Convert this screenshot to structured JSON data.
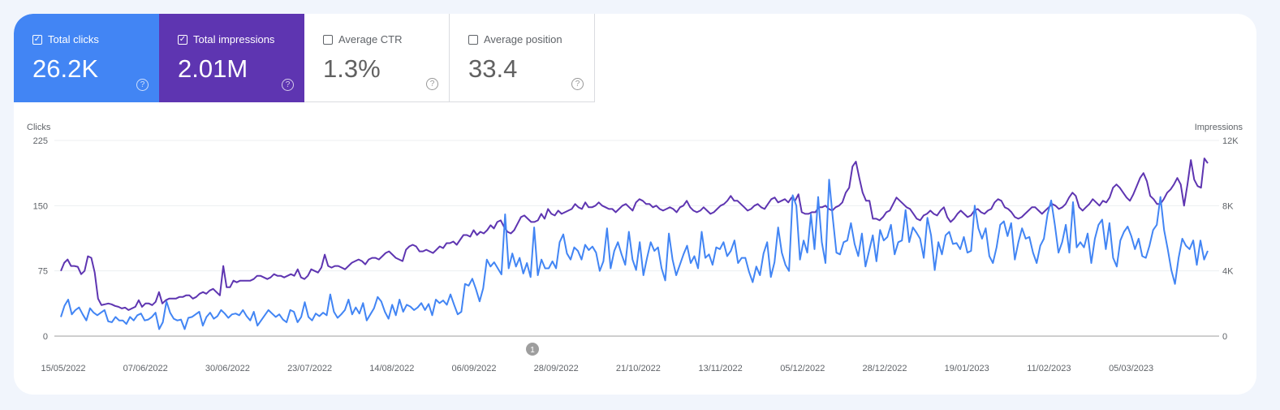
{
  "cards": [
    {
      "label": "Total clicks",
      "value": "26.2K",
      "checked": true,
      "color": "#4285f4",
      "help_icon": "help-circle-icon"
    },
    {
      "label": "Total impressions",
      "value": "2.01M",
      "checked": true,
      "color": "#5e35b1",
      "help_icon": "help-circle-icon"
    },
    {
      "label": "Average CTR",
      "value": "1.3%",
      "checked": false,
      "help_icon": "help-circle-icon"
    },
    {
      "label": "Average position",
      "value": "33.4",
      "checked": false,
      "help_icon": "help-circle-icon"
    }
  ],
  "checkmark": "✓",
  "help_glyph": "?",
  "annotation": {
    "label": "1"
  },
  "chart_data": {
    "type": "line",
    "title": "",
    "left_axis_label": "Clicks",
    "right_axis_label": "Impressions",
    "left_ylim": [
      0,
      225
    ],
    "right_ylim": [
      0,
      12000
    ],
    "left_ticks": [
      "0",
      "75",
      "150",
      "225"
    ],
    "right_ticks": [
      "0",
      "4K",
      "8K",
      "12K"
    ],
    "grid": true,
    "x_start": "15/05/2022",
    "x_end": "24/03/2023",
    "x_tick_labels": [
      "15/05/2022",
      "07/06/2022",
      "30/06/2022",
      "23/07/2022",
      "14/08/2022",
      "06/09/2022",
      "28/09/2022",
      "21/10/2022",
      "13/11/2022",
      "05/12/2022",
      "28/12/2022",
      "19/01/2023",
      "11/02/2023",
      "05/03/2023"
    ],
    "series": [
      {
        "name": "Clicks",
        "axis": "left",
        "color": "#4285f4",
        "values": [
          22,
          35,
          42,
          25,
          30,
          33,
          25,
          18,
          32,
          27,
          24,
          27,
          30,
          17,
          16,
          22,
          18,
          18,
          14,
          22,
          18,
          24,
          26,
          18,
          19,
          22,
          27,
          8,
          16,
          40,
          27,
          20,
          18,
          19,
          8,
          21,
          22,
          25,
          28,
          12,
          22,
          27,
          20,
          23,
          30,
          26,
          21,
          25,
          26,
          24,
          30,
          23,
          18,
          28,
          12,
          18,
          24,
          30,
          26,
          22,
          25,
          19,
          16,
          30,
          28,
          16,
          22,
          39,
          22,
          18,
          26,
          23,
          27,
          24,
          48,
          28,
          21,
          25,
          30,
          42,
          25,
          33,
          26,
          38,
          18,
          25,
          32,
          45,
          40,
          28,
          20,
          36,
          24,
          42,
          28,
          36,
          34,
          30,
          33,
          38,
          30,
          37,
          24,
          42,
          38,
          41,
          36,
          48,
          36,
          25,
          28,
          60,
          58,
          66,
          54,
          40,
          55,
          88,
          80,
          85,
          78,
          71,
          140,
          78,
          95,
          80,
          90,
          72,
          84,
          68,
          125,
          70,
          88,
          78,
          78,
          86,
          78,
          108,
          117,
          95,
          88,
          102,
          98,
          88,
          105,
          99,
          103,
          96,
          75,
          86,
          124,
          78,
          98,
          108,
          94,
          82,
          120,
          88,
          76,
          108,
          70,
          90,
          108,
          98,
          102,
          78,
          64,
          118,
          88,
          70,
          82,
          94,
          104,
          84,
          92,
          78,
          120,
          90,
          94,
          82,
          102,
          100,
          108,
          92,
          98,
          110,
          84,
          90,
          90,
          74,
          62,
          80,
          70,
          95,
          108,
          68,
          85,
          125,
          96,
          82,
          75,
          162,
          150,
          88,
          110,
          96,
          140,
          100,
          160,
          108,
          84,
          180,
          136,
          96,
          94,
          108,
          110,
          130,
          106,
          92,
          118,
          80,
          98,
          116,
          86,
          122,
          110,
          114,
          128,
          94,
          108,
          110,
          145,
          108,
          125,
          119,
          112,
          90,
          136,
          116,
          76,
          108,
          94,
          116,
          120,
          106,
          107,
          100,
          114,
          96,
          98,
          150,
          124,
          112,
          124,
          92,
          84,
          102,
          128,
          132,
          115,
          130,
          88,
          108,
          124,
          112,
          114,
          96,
          84,
          104,
          112,
          140,
          156,
          128,
          96,
          108,
          128,
          96,
          154,
          102,
          108,
          102,
          118,
          84,
          112,
          128,
          134,
          100,
          130,
          90,
          80,
          110,
          120,
          126,
          115,
          100,
          112,
          92,
          90,
          104,
          122,
          128,
          160,
          122,
          100,
          76,
          60,
          90,
          112,
          104,
          100,
          110,
          82,
          110,
          88,
          98
        ]
      },
      {
        "name": "Impressions",
        "axis": "right",
        "color": "#5e35b1",
        "values": [
          4000,
          4500,
          4700,
          4300,
          4300,
          4250,
          3800,
          4000,
          4900,
          4800,
          3900,
          2300,
          1900,
          1950,
          2000,
          1950,
          1850,
          1800,
          1700,
          1750,
          1600,
          1700,
          1800,
          2200,
          1800,
          2000,
          2000,
          1900,
          2100,
          2700,
          2000,
          2200,
          2300,
          2300,
          2300,
          2400,
          2400,
          2500,
          2500,
          2300,
          2400,
          2600,
          2700,
          2600,
          2800,
          2900,
          2700,
          2500,
          4300,
          3000,
          3000,
          3400,
          3300,
          3400,
          3400,
          3400,
          3400,
          3500,
          3700,
          3700,
          3600,
          3500,
          3600,
          3800,
          3700,
          3700,
          3600,
          3700,
          3800,
          3700,
          4100,
          3600,
          3500,
          3700,
          4100,
          4000,
          3900,
          4200,
          5000,
          4300,
          4200,
          4300,
          4300,
          4200,
          4100,
          4300,
          4500,
          4600,
          4700,
          4600,
          4400,
          4700,
          4800,
          4800,
          4700,
          4900,
          5100,
          5200,
          5000,
          4800,
          4700,
          4600,
          5300,
          5500,
          5600,
          5500,
          5200,
          5200,
          5300,
          5200,
          5100,
          5300,
          5500,
          5400,
          5700,
          5700,
          5800,
          5600,
          5900,
          6200,
          6200,
          6100,
          6500,
          6200,
          6400,
          6300,
          6500,
          6800,
          6600,
          7000,
          7100,
          6700,
          6400,
          6300,
          6500,
          6900,
          7300,
          7400,
          7200,
          7000,
          7000,
          7100,
          7500,
          7200,
          7800,
          7500,
          7400,
          7700,
          7500,
          7600,
          7700,
          7800,
          8100,
          7900,
          7800,
          8200,
          7900,
          7900,
          8000,
          8200,
          8000,
          7900,
          7800,
          7800,
          7600,
          7800,
          8000,
          8100,
          7900,
          7700,
          8200,
          8400,
          8300,
          8100,
          8100,
          7900,
          8000,
          7800,
          7700,
          7800,
          7900,
          7800,
          7600,
          7900,
          8000,
          8300,
          7900,
          7700,
          7600,
          7700,
          7900,
          7700,
          7500,
          7600,
          7800,
          8000,
          8100,
          8300,
          8600,
          8300,
          8300,
          8100,
          7900,
          7700,
          7800,
          8000,
          8100,
          7900,
          7800,
          8100,
          8400,
          8500,
          8200,
          8300,
          8400,
          8200,
          8500,
          8300,
          8700,
          7600,
          7500,
          7500,
          7600,
          7600,
          7900,
          7900,
          8000,
          7800,
          7700,
          7900,
          8000,
          8200,
          8800,
          9100,
          10400,
          10700,
          9700,
          8800,
          8300,
          8300,
          7200,
          7200,
          7100,
          7300,
          7600,
          7700,
          8100,
          8500,
          8300,
          8100,
          7900,
          7800,
          7500,
          7200,
          7100,
          7400,
          7500,
          7700,
          7500,
          7400,
          7700,
          7900,
          7300,
          7000,
          7200,
          7500,
          7700,
          7500,
          7300,
          7400,
          7700,
          7800,
          7600,
          7500,
          7700,
          7800,
          8200,
          8400,
          8300,
          7900,
          7800,
          7600,
          7300,
          7200,
          7300,
          7500,
          7700,
          7900,
          7900,
          7700,
          7500,
          7700,
          7900,
          8100,
          8000,
          7800,
          7900,
          8100,
          8500,
          8800,
          8600,
          7900,
          7700,
          7900,
          8100,
          8400,
          8200,
          8000,
          8300,
          8200,
          8500,
          9100,
          9300,
          9100,
          8800,
          8500,
          8300,
          8700,
          9200,
          9700,
          10000,
          9500,
          8600,
          8400,
          8100,
          8100,
          8400,
          8800,
          9000,
          9300,
          9700,
          9300,
          8000,
          9300,
          10800,
          9600,
          9200,
          9100,
          10900,
          10600
        ],
        "_note_smoothing": "approximate daily values read from chart"
      }
    ]
  }
}
